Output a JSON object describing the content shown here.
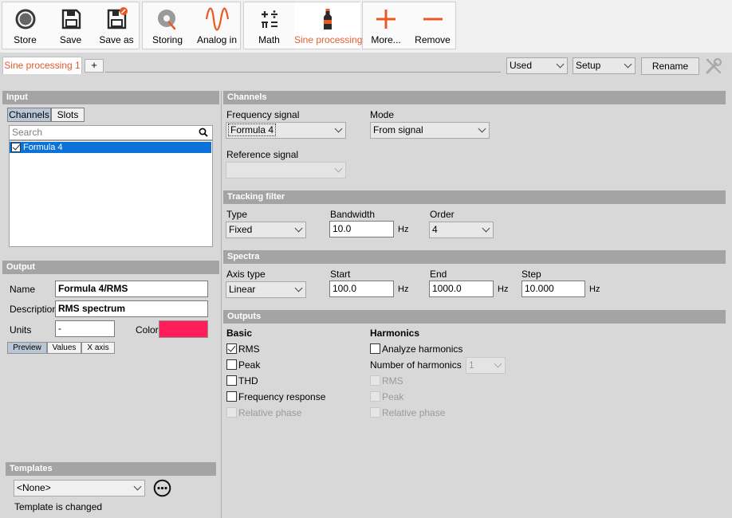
{
  "toolbar": {
    "groups": [
      {
        "items": [
          {
            "label": "Store",
            "icon": "record-circle-icon"
          },
          {
            "label": "Save",
            "icon": "floppy-disk-icon"
          },
          {
            "label": "Save as",
            "icon": "floppy-disk-edit-icon"
          }
        ]
      },
      {
        "items": [
          {
            "label": "Storing",
            "icon": "storing-disc-icon"
          },
          {
            "label": "Analog in",
            "icon": "sine-wave-icon"
          }
        ]
      },
      {
        "items": [
          {
            "label": "Math",
            "icon": "math-operators-icon"
          },
          {
            "label": "Sine processing",
            "icon": "bottle-icon",
            "active": true
          }
        ]
      },
      {
        "items": [
          {
            "label": "More...",
            "icon": "plus-icon"
          },
          {
            "label": "Remove",
            "icon": "minus-icon"
          }
        ]
      }
    ]
  },
  "tabs": {
    "active_tab": "Sine processing 1",
    "add_label": "+",
    "used_select": "Used",
    "setup_select": "Setup",
    "rename_label": "Rename",
    "tools_icon": "wrench-screwdriver-icon"
  },
  "input": {
    "header": "Input",
    "seg_channels": "Channels",
    "seg_slots": "Slots",
    "search_placeholder": "Search",
    "items": [
      {
        "label": "Formula 4",
        "checked": true,
        "selected": true
      }
    ]
  },
  "output": {
    "header": "Output",
    "name_label": "Name",
    "name_value": "Formula 4/RMS",
    "description_label": "Description",
    "description_value": "RMS spectrum",
    "units_label": "Units",
    "units_value": "-",
    "color_label": "Color",
    "color_value": "#ff1e5a",
    "tab_preview": "Preview",
    "tab_values": "Values",
    "tab_xaxis": "X axis"
  },
  "templates": {
    "header": "Templates",
    "select_value": "<None>",
    "status": "Template is changed"
  },
  "channels": {
    "header": "Channels",
    "freq_label": "Frequency signal",
    "freq_value": "Formula 4",
    "mode_label": "Mode",
    "mode_value": "From signal",
    "ref_label": "Reference signal",
    "ref_value": ""
  },
  "tracking": {
    "header": "Tracking filter",
    "type_label": "Type",
    "type_value": "Fixed",
    "bw_label": "Bandwidth",
    "bw_value": "10.0",
    "bw_unit": "Hz",
    "order_label": "Order",
    "order_value": "4"
  },
  "spectra": {
    "header": "Spectra",
    "axis_label": "Axis type",
    "axis_value": "Linear",
    "start_label": "Start",
    "start_value": "100.0",
    "start_unit": "Hz",
    "end_label": "End",
    "end_value": "1000.0",
    "end_unit": "Hz",
    "step_label": "Step",
    "step_value": "10.000",
    "step_unit": "Hz"
  },
  "outputs": {
    "header": "Outputs",
    "basic_title": "Basic",
    "basic": [
      {
        "label": "RMS",
        "checked": true,
        "enabled": true
      },
      {
        "label": "Peak",
        "checked": false,
        "enabled": true
      },
      {
        "label": "THD",
        "checked": false,
        "enabled": true
      },
      {
        "label": "Frequency response",
        "checked": false,
        "enabled": true
      },
      {
        "label": "Relative phase",
        "checked": false,
        "enabled": false
      }
    ],
    "harm_title": "Harmonics",
    "analyze_label": "Analyze harmonics",
    "num_label": "Number of harmonics",
    "num_value": "1",
    "harm_items": [
      {
        "label": "RMS",
        "enabled": false
      },
      {
        "label": "Peak",
        "enabled": false
      },
      {
        "label": "Relative phase",
        "enabled": false
      }
    ]
  },
  "colors": {
    "accent": "#e05a28",
    "selection": "#0a72d8",
    "section_header": "#a4a4a4"
  }
}
